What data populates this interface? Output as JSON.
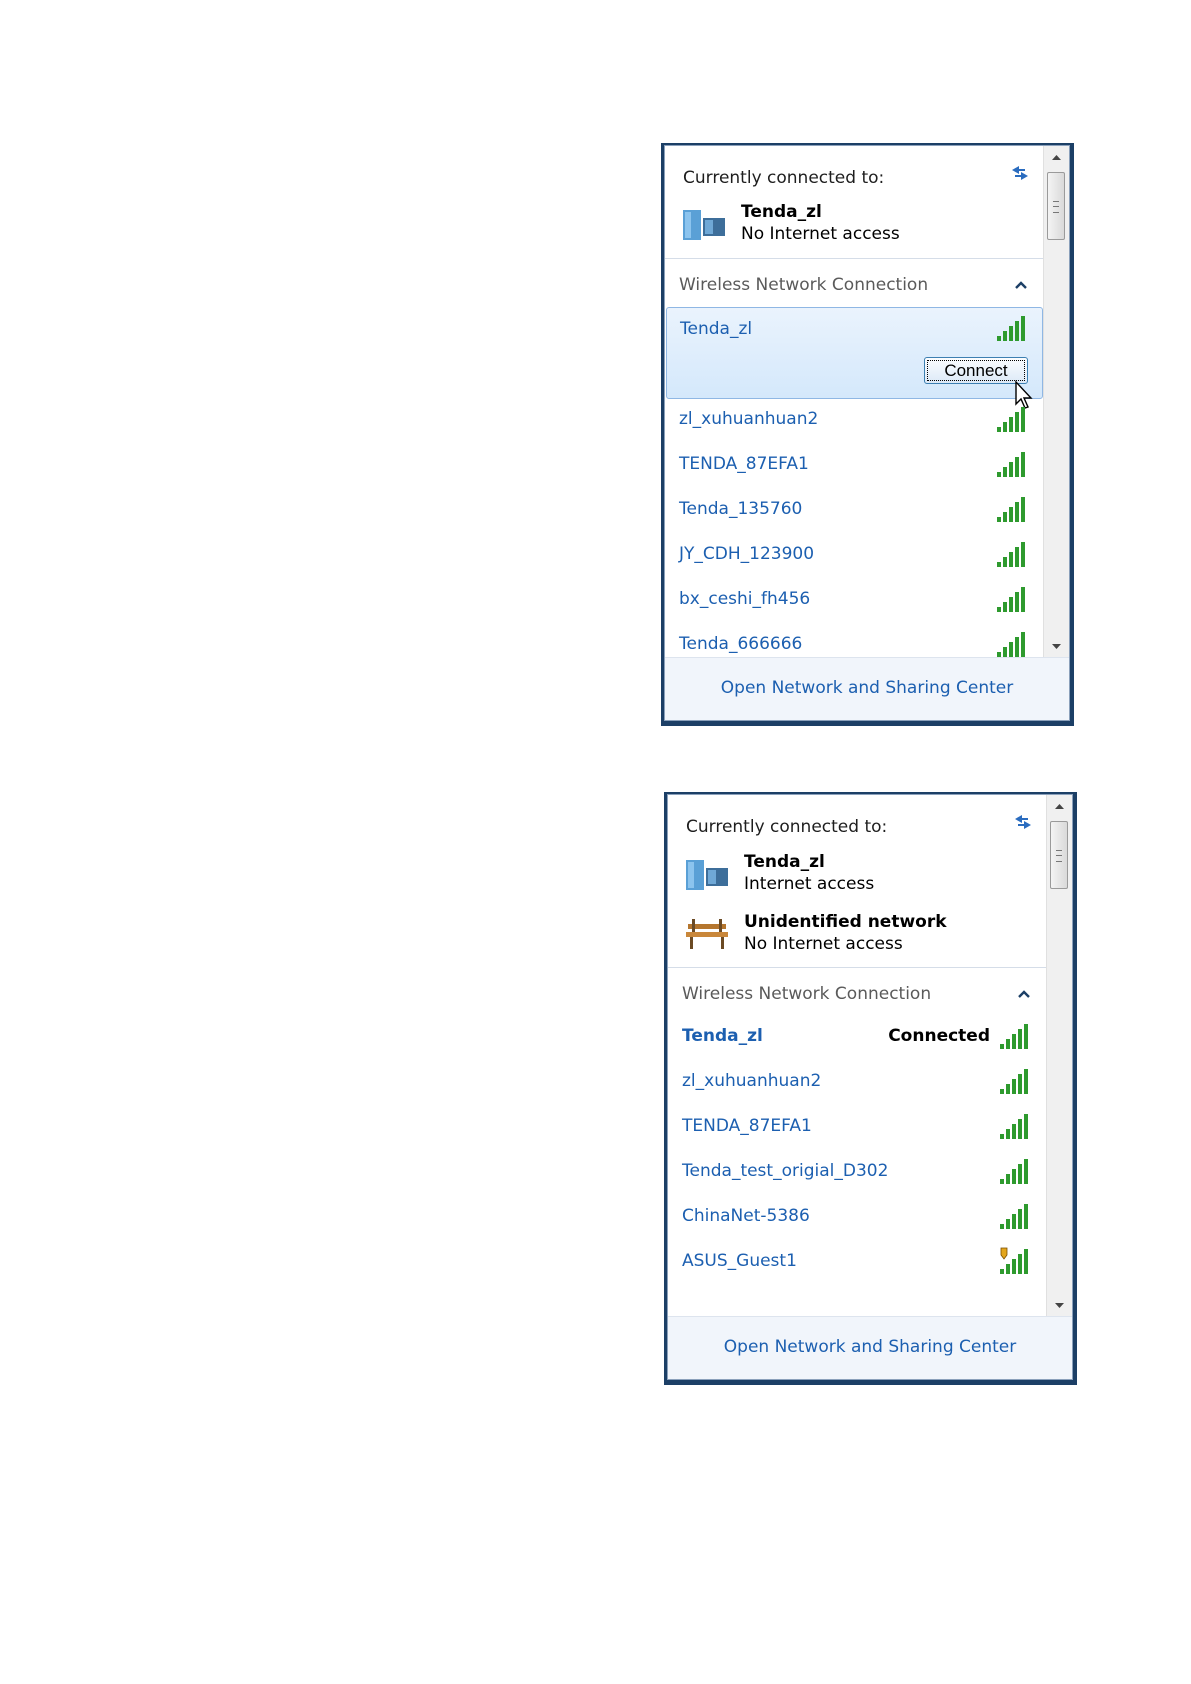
{
  "flyout_top": {
    "header": {
      "title": "Currently connected to:",
      "connections": [
        {
          "name": "Tenda_zl",
          "status": "No Internet access",
          "icon": "network-icon"
        }
      ]
    },
    "section": {
      "title": "Wireless Network Connection"
    },
    "selected_network": {
      "name": "Tenda_zl",
      "connect_label": "Connect"
    },
    "networks": [
      {
        "name": "zl_xuhuanhuan2"
      },
      {
        "name": "TENDA_87EFA1"
      },
      {
        "name": "Tenda_135760"
      },
      {
        "name": "JY_CDH_123900"
      },
      {
        "name": "bx_ceshi_fh456"
      },
      {
        "name": "Tenda_666666"
      }
    ],
    "footer_link": "Open Network and Sharing Center"
  },
  "flyout_bottom": {
    "header": {
      "title": "Currently connected to:",
      "connections": [
        {
          "name": "Tenda_zl",
          "status": "Internet access",
          "icon": "network-icon"
        },
        {
          "name": "Unidentified network",
          "status": "No Internet access",
          "icon": "bench-icon"
        }
      ]
    },
    "section": {
      "title": "Wireless Network Connection"
    },
    "connected_network": {
      "name": "Tenda_zl",
      "status": "Connected"
    },
    "networks": [
      {
        "name": "zl_xuhuanhuan2",
        "secured": false
      },
      {
        "name": "TENDA_87EFA1",
        "secured": false
      },
      {
        "name": "Tenda_test_origial_D302",
        "secured": false
      },
      {
        "name": "ChinaNet-5386",
        "secured": false
      },
      {
        "name": "ASUS_Guest1",
        "secured": true
      }
    ],
    "footer_link": "Open Network and Sharing Center"
  },
  "colors": {
    "link": "#1c5fb0",
    "signal": "#2e9a2e",
    "frame": "#1c3f66"
  }
}
